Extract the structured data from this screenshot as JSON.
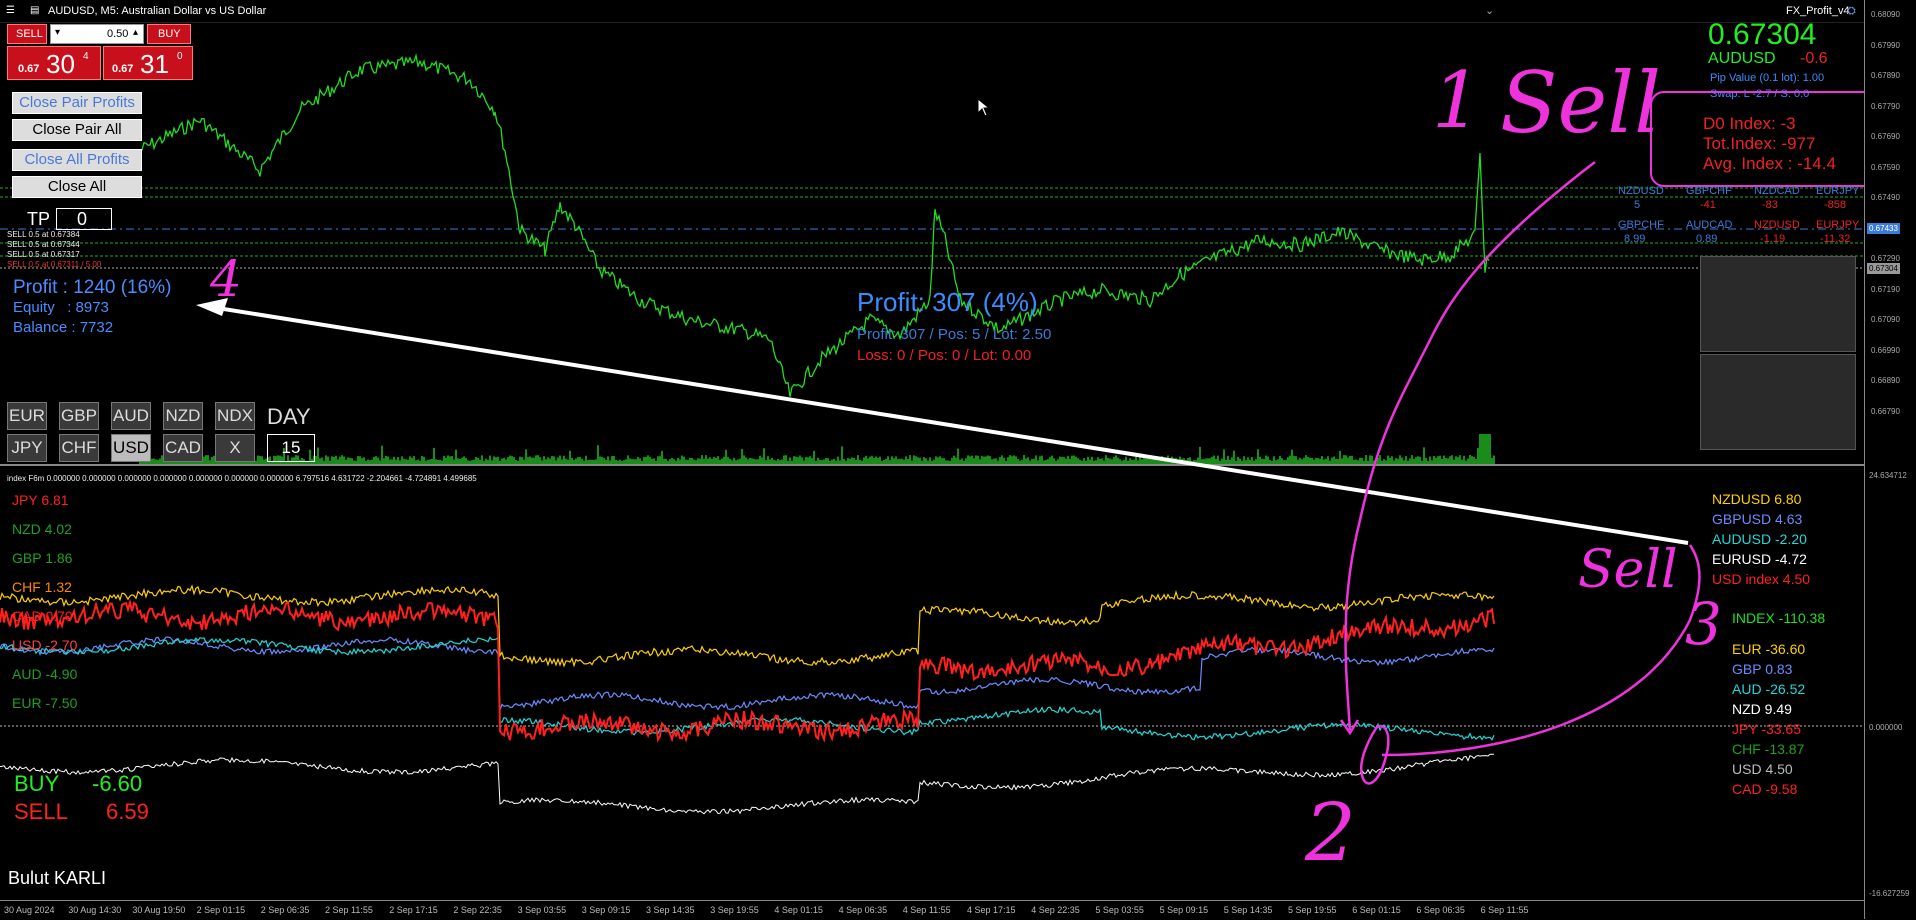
{
  "window": {
    "title": "AUDUSD, M5:  Australian Dollar vs US Dollar",
    "indicator_name": "FX_Profit_v4"
  },
  "trade_panel": {
    "sell_label": "SELL",
    "buy_label": "BUY",
    "lot_value": "0.50",
    "sell_price_prefix": "0.67",
    "sell_price_big": "30",
    "sell_price_sup": "4",
    "buy_price_prefix": "0.67",
    "buy_price_big": "31",
    "buy_price_sup": "0"
  },
  "buttons": {
    "close_pair_profits": "Close Pair Profits",
    "close_pair_all": "Close Pair All",
    "close_all_profits": "Close All Profits",
    "close_all": "Close All"
  },
  "tp": {
    "label": "TP",
    "value": "0"
  },
  "positions": [
    "SELL 0.5 at 0.67384",
    "SELL 0.5 at 0.67344",
    "SELL 0.5 at 0.67317",
    "SELL 0.5 at 0.67311 / 5.00"
  ],
  "account": {
    "profit": "Profit : 1240 (16%)",
    "equity": "Equity   : 8973",
    "balance": "Balance : 7732"
  },
  "pair_stats": {
    "profit_big": "Profit: 307 (4%)",
    "profit_detail": "Profit: 307 / Pos: 5 / Lot: 2.50",
    "loss_detail": "Loss: 0 / Pos: 0 / Lot: 0.00"
  },
  "currency_buttons": {
    "row1": [
      "EUR",
      "GBP",
      "AUD",
      "NZD",
      "NDX"
    ],
    "row2": [
      "JPY",
      "CHF",
      "USD",
      "CAD",
      "X"
    ],
    "day_label": "DAY",
    "day_value": "15"
  },
  "quote": {
    "price": "0.67304",
    "symbol": "AUDUSD",
    "change": "-0.6",
    "pip_value": "Pip Value (0.1 lot): 1.00",
    "swap": "Swap: L -2.7 / S: 0.0"
  },
  "index_box": {
    "d0": "D0 Index: -3",
    "tot": "Tot.Index: -977",
    "avg": "Avg. Index : -14.4"
  },
  "pair_grid": {
    "row1_names": [
      "NZDUSD",
      "GBPCHF",
      "NZDCAD",
      "EURJPY"
    ],
    "row1_values": [
      "5",
      "-41",
      "-83",
      "-858"
    ],
    "row2_names": [
      "GBPCHF",
      "AUDCAD",
      "NZDUSD",
      "EURJPY"
    ],
    "row2_values": [
      "8.99",
      "0.89",
      "-1.19",
      "-11.32"
    ]
  },
  "price_axis": [
    "0.68090",
    "0.67990",
    "0.67890",
    "0.67790",
    "0.67690",
    "0.67590",
    "0.67490",
    "0.67390",
    "0.67290",
    "0.67190",
    "0.67090",
    "0.66990",
    "0.66890",
    "0.66790"
  ],
  "price_markers": {
    "bid": "0.67304",
    "line": "0.67433"
  },
  "index_axis": {
    "top": "24.634712",
    "zero": "0.000000",
    "bottom": "-16.627259"
  },
  "index_header": "index F6m 0.000000 0.000000 0.000000 0.000000 0.000000 0.000000 0.000000 6.797516 4.631722 -2.204661 -4.724891 4.499685",
  "left_legend": [
    {
      "name": "JPY",
      "value": "6.81",
      "color": "#ff2020"
    },
    {
      "name": "NZD",
      "value": "4.02",
      "color": "#20a020"
    },
    {
      "name": "GBP",
      "value": "1.86",
      "color": "#20a020"
    },
    {
      "name": "CHF",
      "value": "1.32",
      "color": "#ff8800"
    },
    {
      "name": "CAD",
      "value": "0.70",
      "color": "#ff2020"
    },
    {
      "name": "USD",
      "value": "-2.70",
      "color": "#ff4040"
    },
    {
      "name": "AUD",
      "value": "-4.90",
      "color": "#20a020"
    },
    {
      "name": "EUR",
      "value": "-7.50",
      "color": "#20a020"
    }
  ],
  "buy_sell_totals": {
    "buy_label": "BUY",
    "buy_value": "-6.60",
    "sell_label": "SELL",
    "sell_value": "6.59"
  },
  "right_pairs": [
    {
      "name": "NZDUSD",
      "value": "6.80",
      "color": "#ffd000"
    },
    {
      "name": "GBPUSD",
      "value": "4.63",
      "color": "#6a8cff"
    },
    {
      "name": "AUDUSD",
      "value": "-2.20",
      "color": "#20d8d8"
    },
    {
      "name": "EURUSD",
      "value": "-4.72",
      "color": "#ffffff"
    },
    {
      "name": "USD index",
      "value": "4.50",
      "color": "#ff2020"
    }
  ],
  "right_index": {
    "name": "INDEX",
    "value": "-110.38",
    "color": "#20e020"
  },
  "right_currencies": [
    {
      "name": "EUR",
      "value": "-36.60",
      "color": "#ffd000"
    },
    {
      "name": "GBP",
      "value": "0.83",
      "color": "#6a8cff"
    },
    {
      "name": "AUD",
      "value": "-26.52",
      "color": "#20d8d8"
    },
    {
      "name": "NZD",
      "value": "9.49",
      "color": "#ffffff"
    },
    {
      "name": "JPY",
      "value": "-33.65",
      "color": "#ff2020"
    },
    {
      "name": "CHF",
      "value": "-13.87",
      "color": "#20a020"
    },
    {
      "name": "USD",
      "value": "4.50",
      "color": "#bbbbbb"
    },
    {
      "name": "CAD",
      "value": "-9.58",
      "color": "#ff2020"
    }
  ],
  "author": "Bulut KARLI",
  "time_axis": [
    "30 Aug 2024",
    "30 Aug 14:30",
    "30 Aug 19:50",
    "2 Sep 01:15",
    "2 Sep 06:35",
    "2 Sep 11:55",
    "2 Sep 17:15",
    "2 Sep 22:35",
    "3 Sep 03:55",
    "3 Sep 09:15",
    "3 Sep 14:35",
    "3 Sep 19:55",
    "4 Sep 01:15",
    "4 Sep 06:35",
    "4 Sep 11:55",
    "4 Sep 17:15",
    "4 Sep 22:35",
    "5 Sep 03:55",
    "5 Sep 09:15",
    "5 Sep 14:35",
    "5 Sep 19:55",
    "6 Sep 01:15",
    "6 Sep 06:35",
    "6 Sep 11:55"
  ],
  "annotations": {
    "a1": "1",
    "sell1": "Sell",
    "a2": "2",
    "a3": "3",
    "a4": "4",
    "sell2": "Sell"
  },
  "colors": {
    "price_line": "#22dd22",
    "sell_btn": "#c8101c",
    "annotation": "#ee33dd",
    "link": "#4a78d8"
  }
}
